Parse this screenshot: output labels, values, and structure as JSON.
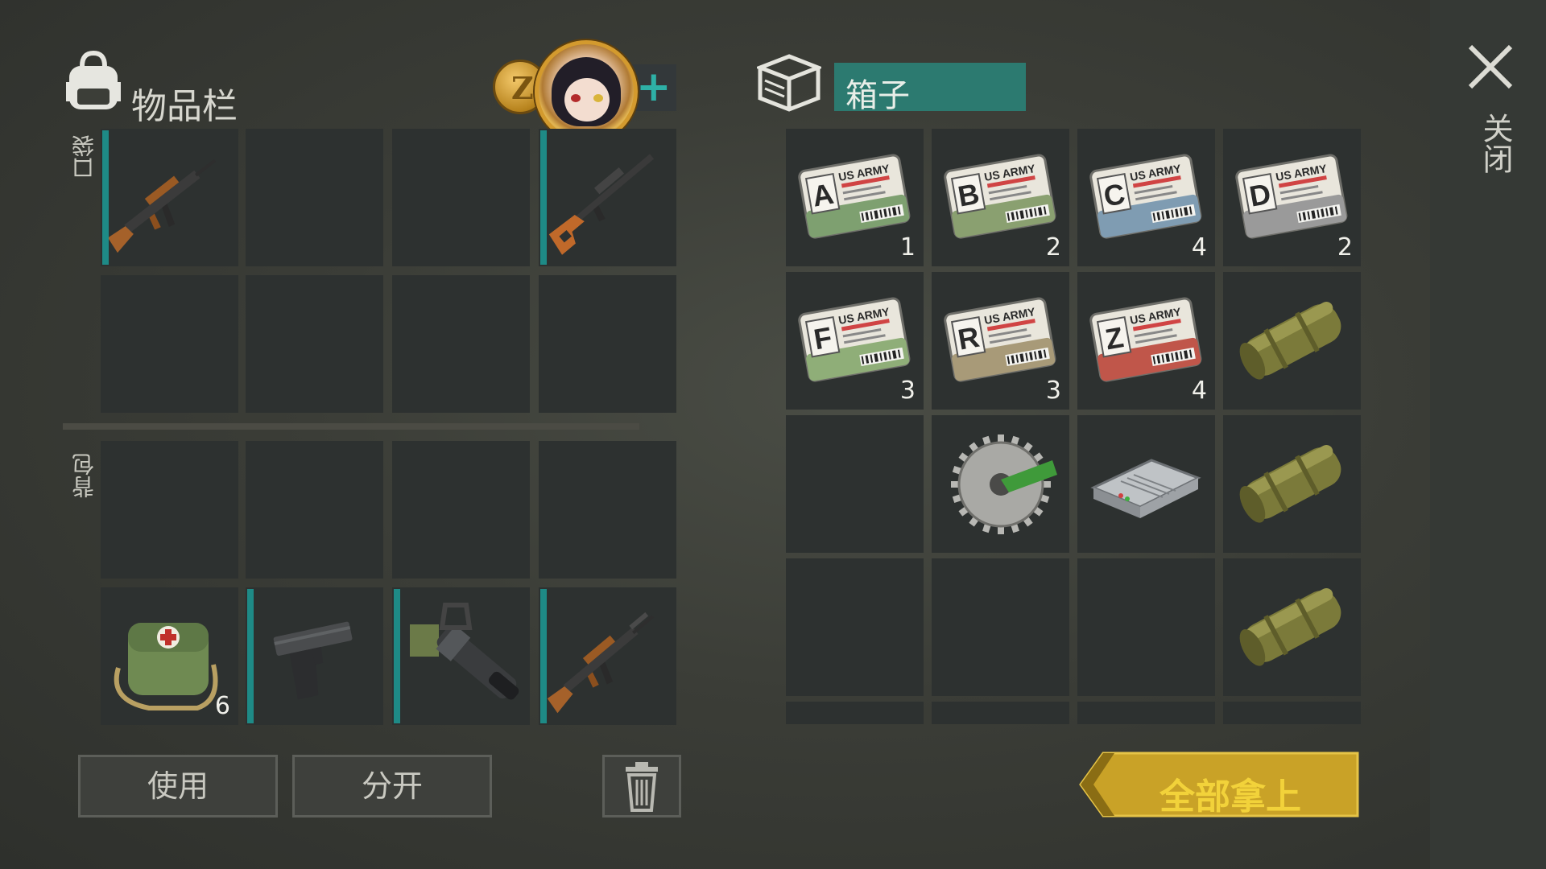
{
  "header": {
    "inventory_title": "物品栏",
    "coin_letter": "Z"
  },
  "labels": {
    "pockets": "口袋",
    "backpack": "背包",
    "close": "关闭"
  },
  "buttons": {
    "use": "使用",
    "split": "分开",
    "take_all": "全部拿上"
  },
  "container": {
    "title": "箱子"
  },
  "inventory": {
    "pockets": [
      {
        "icon": "ak-rifle-icon",
        "count": "",
        "equipped": true
      },
      {
        "icon": "",
        "count": "",
        "equipped": false
      },
      {
        "icon": "",
        "count": "",
        "equipped": false
      },
      {
        "icon": "sniper-rifle-icon",
        "count": "",
        "equipped": true
      },
      {
        "icon": "",
        "count": "",
        "equipped": false
      },
      {
        "icon": "",
        "count": "",
        "equipped": false
      },
      {
        "icon": "",
        "count": "",
        "equipped": false
      },
      {
        "icon": "",
        "count": "",
        "equipped": false
      }
    ],
    "backpack": [
      {
        "icon": "",
        "count": ""
      },
      {
        "icon": "",
        "count": ""
      },
      {
        "icon": "",
        "count": ""
      },
      {
        "icon": "",
        "count": ""
      },
      {
        "icon": "medkit-bag-icon",
        "count": "6"
      },
      {
        "icon": "pistol-icon",
        "count": ""
      },
      {
        "icon": "minigun-icon",
        "count": ""
      },
      {
        "icon": "ak-rifle-icon",
        "count": ""
      }
    ]
  },
  "box_items": [
    {
      "icon": "keycard-icon",
      "letter": "A",
      "card_color": "#7ea070",
      "count": "1"
    },
    {
      "icon": "keycard-icon",
      "letter": "B",
      "card_color": "#8aa070",
      "count": "2"
    },
    {
      "icon": "keycard-icon",
      "letter": "C",
      "card_color": "#7f9cb2",
      "count": "4"
    },
    {
      "icon": "keycard-icon",
      "letter": "D",
      "card_color": "#9a9a9a",
      "count": "2"
    },
    {
      "icon": "keycard-icon",
      "letter": "F",
      "card_color": "#8fae78",
      "count": "3"
    },
    {
      "icon": "keycard-icon",
      "letter": "R",
      "card_color": "#a89a78",
      "count": "3"
    },
    {
      "icon": "keycard-icon",
      "letter": "Z",
      "card_color": "#c0564a",
      "count": "4"
    },
    {
      "icon": "fuel-canister-icon",
      "count": ""
    },
    {
      "icon": "",
      "count": ""
    },
    {
      "icon": "circular-saw-blade-icon",
      "count": ""
    },
    {
      "icon": "electronic-device-icon",
      "count": ""
    },
    {
      "icon": "fuel-canister-icon",
      "count": ""
    },
    {
      "icon": "",
      "count": ""
    },
    {
      "icon": "",
      "count": ""
    },
    {
      "icon": "",
      "count": ""
    },
    {
      "icon": "fuel-canister-icon",
      "count": ""
    }
  ],
  "keycard_text": "US ARMY",
  "colors": {
    "accent_teal": "#2c7a70",
    "take_all_yellow": "#c9a227",
    "slot_bg": "#2d3130"
  }
}
